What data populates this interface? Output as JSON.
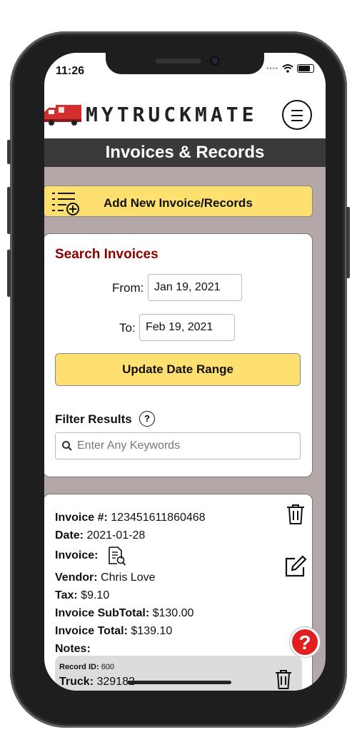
{
  "status": {
    "time": "11:26"
  },
  "header": {
    "brand": "MYTRUCKMATE"
  },
  "page": {
    "title": "Invoices & Records"
  },
  "actions": {
    "add_label": "Add New Invoice/Records"
  },
  "search": {
    "title": "Search Invoices",
    "from_label": "From:",
    "from_value": "Jan 19, 2021",
    "to_label": "To:",
    "to_value": "Feb 19, 2021",
    "update_label": "Update Date Range",
    "filter_label": "Filter Results",
    "help_symbol": "?",
    "keyword_placeholder": "Enter Any Keywords"
  },
  "invoice": {
    "number_label": "Invoice #:",
    "number": "123451611860468",
    "date_label": "Date:",
    "date": "2021-01-28",
    "invoice_label": "Invoice:",
    "vendor_label": "Vendor:",
    "vendor": "Chris Love",
    "tax_label": "Tax:",
    "tax": "$9.10",
    "subtotal_label": "Invoice SubTotal:",
    "subtotal": "$130.00",
    "total_label": "Invoice Total:",
    "total": "$139.10",
    "notes_label": "Notes:",
    "record_id_label": "Record ID:",
    "record_id": "600",
    "truck_label": "Truck:",
    "truck": "329182"
  },
  "help_fab": {
    "symbol": "?"
  },
  "colors": {
    "accent_yellow": "#fde06f",
    "title_red": "#8b0000",
    "titlebar": "#3a3a3a",
    "background": "#b3a8a7",
    "truck_red": "#d32f2f"
  }
}
